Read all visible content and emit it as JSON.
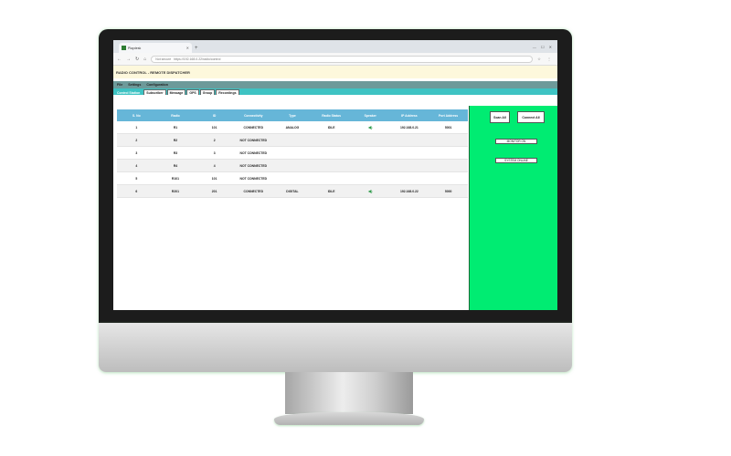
{
  "browser": {
    "tab_title": "Playdesk",
    "address": "https://192.168.0.22/radio/control",
    "secure_label": "Not secure"
  },
  "app": {
    "title": "RADIO CONTROL - REMOTE DISPATCHER",
    "menu": [
      "File",
      "Settings",
      "Configuration"
    ],
    "tabs": [
      "Control Station",
      "Subscriber",
      "Message",
      "GPS",
      "Group",
      "Recordings"
    ],
    "active_tab": 0
  },
  "table": {
    "columns": [
      "S. No",
      "Radio",
      "ID",
      "Connectivity",
      "Type",
      "Radio Status",
      "Speaker",
      "IP Address",
      "Port Address"
    ],
    "rows": [
      [
        "1",
        "R1",
        "101",
        "CONNECTED",
        "ANALOG",
        "IDLE",
        "◀)",
        "192.168.0.21",
        "5001"
      ],
      [
        "2",
        "R2",
        "2",
        "NOT CONNECTED",
        "",
        "",
        "",
        "",
        ""
      ],
      [
        "3",
        "R3",
        "3",
        "NOT CONNECTED",
        "",
        "",
        "",
        "",
        ""
      ],
      [
        "4",
        "R4",
        "4",
        "NOT CONNECTED",
        "",
        "",
        "",
        "",
        ""
      ],
      [
        "5",
        "R101",
        "101",
        "NOT CONNECTED",
        "",
        "",
        "",
        "",
        ""
      ],
      [
        "6",
        "R201",
        "201",
        "CONNECTED",
        "DIGITAL",
        "IDLE",
        "◀)",
        "192.168.0.22",
        "5000"
      ]
    ]
  },
  "side": {
    "buttons": [
      "Scan All",
      "Connect All"
    ],
    "tags": [
      "MONITOR ON",
      "SYSTEM ONLINE"
    ]
  },
  "colors": {
    "side_bg": "#00ec72",
    "header": "#66b6d8",
    "toolbar": "#3ec3c3"
  }
}
